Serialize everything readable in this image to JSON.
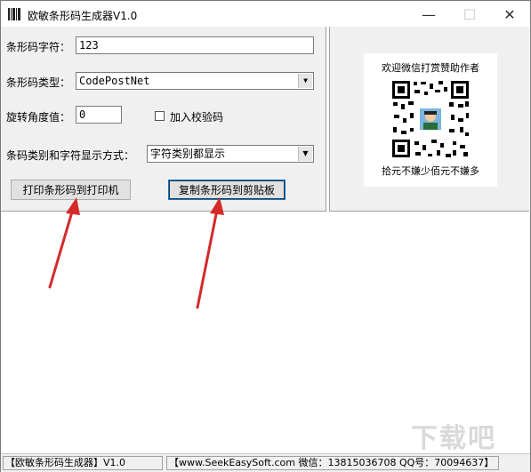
{
  "window": {
    "title": "欧敏条形码生成器V1.0",
    "minimize": "—",
    "maximize": "☐",
    "close": "✕"
  },
  "form": {
    "barcode_text_label": "条形码字符：",
    "barcode_text_value": "123",
    "barcode_type_label": "条形码类型：",
    "barcode_type_value": "CodePostNet",
    "rotation_label": "旋转角度值：",
    "rotation_value": "0",
    "checksum_label": "加入校验码",
    "display_mode_label": "条码类别和字符显示方式：",
    "display_mode_value": "字符类别都显示",
    "print_button": "打印条形码到打印机",
    "copy_button": "复制条形码到剪贴板"
  },
  "donate": {
    "top_text": "欢迎微信打赏赞助作者",
    "bottom_text": "拾元不嫌少佰元不嫌多"
  },
  "statusbar": {
    "app_name": "【欧敏条形码生成器】V1.0",
    "contact": "【www.SeekEasySoft.com 微信：13815036708 QQ号：70094637】"
  },
  "watermark": "下载吧",
  "colors": {
    "arrow": "#d42a2a",
    "panel": "#f0f0f0",
    "focus": "#0078d7"
  }
}
